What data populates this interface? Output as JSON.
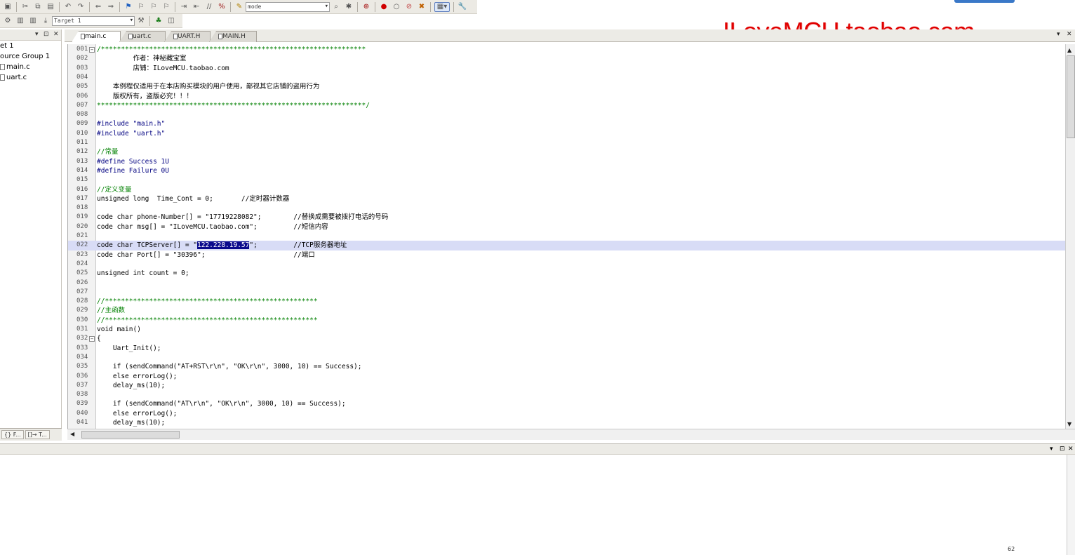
{
  "toolbar": {
    "build_target": "Target 1",
    "find_combo": "mode"
  },
  "project": {
    "items": [
      {
        "label": "et 1"
      },
      {
        "label": "ource Group 1"
      },
      {
        "label": "main.c"
      },
      {
        "label": "uart.c"
      }
    ],
    "tabs": [
      "{} F...",
      "[]→ T..."
    ]
  },
  "editor": {
    "tabs": [
      {
        "label": "main.c",
        "active": true
      },
      {
        "label": "uart.c",
        "active": false
      },
      {
        "label": "UART.H",
        "active": false
      },
      {
        "label": "MAIN.H",
        "active": false
      }
    ],
    "lines": [
      {
        "n": "001",
        "t": "/******************************************************************"
      },
      {
        "n": "002",
        "t": "         作者：神秘藏宝室"
      },
      {
        "n": "003",
        "t": "         店铺：ILoveMCU.taobao.com"
      },
      {
        "n": "004",
        "t": ""
      },
      {
        "n": "005",
        "t": "    本例程仅适用于在本店购买模块的用户使用，鄙视其它店铺的盗用行为"
      },
      {
        "n": "006",
        "t": "    版权所有，盗版必究！！！"
      },
      {
        "n": "007",
        "t": "*******************************************************************/"
      },
      {
        "n": "008",
        "t": ""
      },
      {
        "n": "009",
        "t": "#include \"main.h\""
      },
      {
        "n": "010",
        "t": "#include \"uart.h\""
      },
      {
        "n": "011",
        "t": ""
      },
      {
        "n": "012",
        "t": "//常量"
      },
      {
        "n": "013",
        "t": "#define Success 1U"
      },
      {
        "n": "014",
        "t": "#define Failure 0U"
      },
      {
        "n": "015",
        "t": ""
      },
      {
        "n": "016",
        "t": "//定义变量"
      },
      {
        "n": "017",
        "t": "unsigned long  Time_Cont = 0;       //定时器计数器"
      },
      {
        "n": "018",
        "t": ""
      },
      {
        "n": "019",
        "t": "code char phone-Number[] = \"17719228082\";        //替换成需要被拨打电话的号码"
      },
      {
        "n": "020",
        "t": "code char msg[] = \"ILoveMCU.taobao.com\";         //短信内容"
      },
      {
        "n": "021",
        "t": ""
      },
      {
        "n": "022",
        "pre": "code char TCPServer[] = \"",
        "sel": "122.228.19.57",
        "post": "\";         //TCP服务器地址"
      },
      {
        "n": "023",
        "t": "code char Port[] = \"30396\";                      //端口"
      },
      {
        "n": "024",
        "t": ""
      },
      {
        "n": "025",
        "t": "unsigned int count = 0;"
      },
      {
        "n": "026",
        "t": ""
      },
      {
        "n": "027",
        "t": ""
      },
      {
        "n": "028",
        "t": "//*****************************************************"
      },
      {
        "n": "029",
        "t": "//主函数"
      },
      {
        "n": "030",
        "t": "//*****************************************************"
      },
      {
        "n": "031",
        "t": "void main()"
      },
      {
        "n": "032",
        "t": "{"
      },
      {
        "n": "033",
        "t": "    Uart_Init();"
      },
      {
        "n": "034",
        "t": ""
      },
      {
        "n": "035",
        "t": "    if (sendCommand(\"AT+RST\\r\\n\", \"OK\\r\\n\", 3000, 10) == Success);"
      },
      {
        "n": "036",
        "t": "    else errorLog();"
      },
      {
        "n": "037",
        "t": "    delay_ms(10);"
      },
      {
        "n": "038",
        "t": ""
      },
      {
        "n": "039",
        "t": "    if (sendCommand(\"AT\\r\\n\", \"OK\\r\\n\", 3000, 10) == Success);"
      },
      {
        "n": "040",
        "t": "    else errorLog();"
      },
      {
        "n": "041",
        "t": "    delay_ms(10);"
      }
    ]
  },
  "watermark": "ILoveMCU.taobao.com",
  "corner_text": "62",
  "colors": {
    "selection": "#0a0a8c",
    "current_line": "#d8dcf6",
    "comment": "#008000",
    "keyword": "#0000b0",
    "watermark": "#e00000"
  }
}
